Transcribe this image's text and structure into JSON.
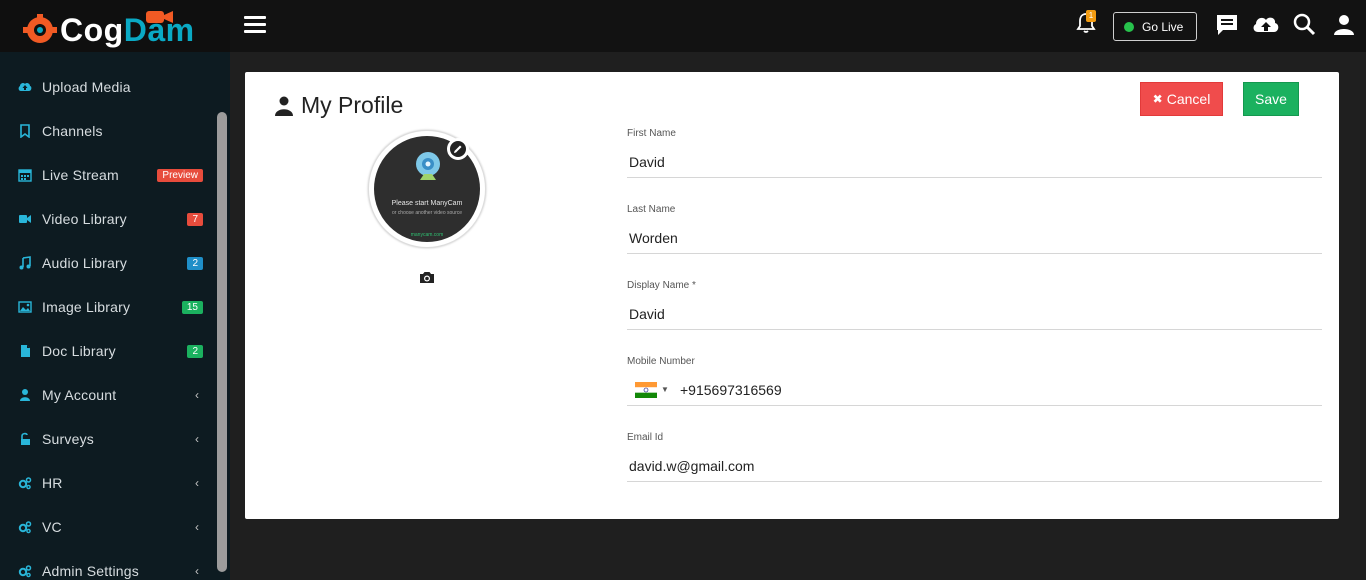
{
  "brand": {
    "part1": "Cog",
    "part2": "Dam"
  },
  "header": {
    "go_live_label": "Go Live",
    "notification_count": "1",
    "icons": [
      "menu-icon",
      "bell-icon",
      "chat-icon",
      "cloud-upload-icon",
      "search-icon",
      "user-icon"
    ]
  },
  "sidebar": {
    "items": [
      {
        "label": "Upload Media",
        "icon": "cloud-upload-icon"
      },
      {
        "label": "Channels",
        "icon": "bookmark-icon"
      },
      {
        "label": "Live Stream",
        "icon": "calendar-icon",
        "badge": "Preview",
        "badge_color": "#e74c3c"
      },
      {
        "label": "Video Library",
        "icon": "video-camera-icon",
        "badge": "7",
        "badge_color": "#e74c3c"
      },
      {
        "label": "Audio Library",
        "icon": "music-icon",
        "badge": "2",
        "badge_color": "#1f8fc8"
      },
      {
        "label": "Image Library",
        "icon": "image-icon",
        "badge": "15",
        "badge_color": "#1bb15f"
      },
      {
        "label": "Doc Library",
        "icon": "document-icon",
        "badge": "2",
        "badge_color": "#1bb15f"
      },
      {
        "label": "My Account",
        "icon": "user-icon",
        "chevron": "‹"
      },
      {
        "label": "Surveys",
        "icon": "unlock-icon",
        "chevron": "‹"
      },
      {
        "label": "HR",
        "icon": "cogs-icon",
        "chevron": "‹"
      },
      {
        "label": "VC",
        "icon": "cogs-icon",
        "chevron": "‹"
      },
      {
        "label": "Admin Settings",
        "icon": "cogs-icon",
        "chevron": "‹"
      }
    ]
  },
  "profile": {
    "title": "My Profile",
    "cancel_label": "Cancel",
    "save_label": "Save",
    "avatar_text": "Please start ManyCam",
    "avatar_subtext": "or choose another video source",
    "avatar_link": "manycam.com",
    "fields": {
      "first_name": {
        "label": "First Name",
        "value": "David"
      },
      "last_name": {
        "label": "Last Name",
        "value": "Worden"
      },
      "display_name": {
        "label": "Display Name *",
        "value": "David"
      },
      "mobile": {
        "label": "Mobile Number",
        "value": "+915697316569",
        "country": "India"
      },
      "email": {
        "label": "Email Id",
        "value": "david.w@gmail.com"
      }
    }
  },
  "colors": {
    "accent": "#0aa9c4",
    "cancel": "#f04c4c",
    "save": "#1bb15f",
    "sidebar_bg": "#0d1b21",
    "topbar_bg": "#121212"
  }
}
